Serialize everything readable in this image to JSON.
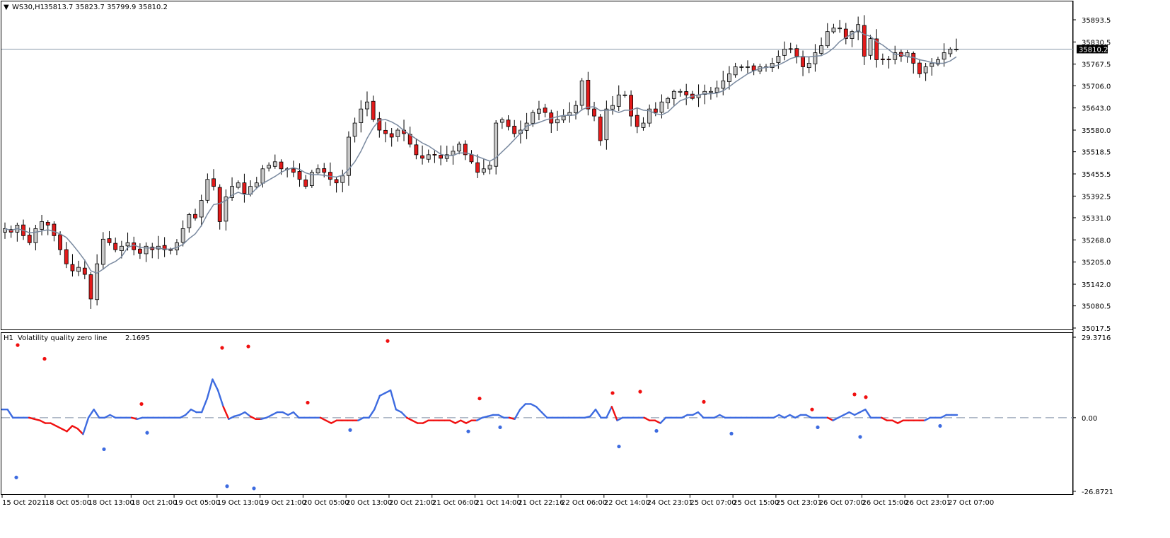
{
  "header": {
    "menu_glyph": "▼",
    "symbol": "WS30,H1",
    "ohlc": "35813.7 35823.7 35799.9 35810.2"
  },
  "indicator_header": {
    "timeframe": "H1",
    "name": "Volatility quality zero line",
    "value": "2.1695"
  },
  "colors": {
    "bull_candle": "#c8c8c8",
    "bear_candle": "#e31a1a",
    "candle_outline": "#000000",
    "moving_average": "#7a8aa0",
    "price_line": "#8899aa",
    "indicator_up": "#3d6be0",
    "indicator_down": "#f01010",
    "zero_line": "#8090a8"
  },
  "chart_data": [
    {
      "type": "candlestick",
      "name": "WS30,H1",
      "current_price": 35810.2,
      "price_label": "35810.2",
      "ylim": [
        35000,
        35930
      ],
      "y_ticks": [
        "35893.5",
        "35830.5",
        "35767.5",
        "35706.0",
        "35643.0",
        "35580.0",
        "35518.5",
        "35455.5",
        "35392.5",
        "35331.0",
        "35268.0",
        "35205.0",
        "35142.0",
        "35080.5",
        "35017.5"
      ],
      "x_ticks": [
        "15 Oct 2021",
        "18 Oct 05:00",
        "18 Oct 13:00",
        "18 Oct 21:00",
        "19 Oct 05:00",
        "19 Oct 13:00",
        "19 Oct 21:00",
        "20 Oct 05:00",
        "20 Oct 13:00",
        "20 Oct 21:00",
        "21 Oct 06:00",
        "21 Oct 14:00",
        "21 Oct 22:16",
        "22 Oct 06:00",
        "22 Oct 14:00",
        "24 Oct 23:01",
        "25 Oct 07:00",
        "25 Oct 15:00",
        "25 Oct 23:01",
        "26 Oct 07:00",
        "26 Oct 15:00",
        "26 Oct 23:01",
        "27 Oct 07:00"
      ],
      "close_path": [
        35300,
        35290,
        35310,
        35280,
        35260,
        35300,
        35320,
        35310,
        35280,
        35240,
        35200,
        35180,
        35190,
        35170,
        35100,
        35200,
        35270,
        35260,
        35240,
        35250,
        35260,
        35240,
        35230,
        35250,
        35240,
        35250,
        35240,
        35240,
        35260,
        35300,
        35340,
        35330,
        35380,
        35440,
        35420,
        35320,
        35390,
        35420,
        35430,
        35400,
        35420,
        35430,
        35470,
        35480,
        35490,
        35470,
        35470,
        35460,
        35440,
        35420,
        35460,
        35470,
        35460,
        35440,
        35430,
        35450,
        35560,
        35600,
        35640,
        35660,
        35610,
        35580,
        35570,
        35560,
        35580,
        35570,
        35540,
        35510,
        35500,
        35510,
        35510,
        35500,
        35510,
        35520,
        35540,
        35510,
        35490,
        35460,
        35470,
        35480,
        35600,
        35610,
        35590,
        35570,
        35580,
        35600,
        35630,
        35640,
        35630,
        35600,
        35610,
        35620,
        35630,
        35650,
        35720,
        35640,
        35620,
        35550,
        35640,
        35650,
        35680,
        35680,
        35620,
        35590,
        35600,
        35640,
        35630,
        35660,
        35670,
        35690,
        35690,
        35680,
        35670,
        35680,
        35690,
        35690,
        35700,
        35720,
        35740,
        35760,
        35760,
        35760,
        35750,
        35760,
        35760,
        35770,
        35790,
        35810,
        35810,
        35790,
        35760,
        35770,
        35800,
        35820,
        35860,
        35870,
        35870,
        35840,
        35860,
        35880,
        35790,
        35840,
        35780,
        35780,
        35780,
        35800,
        35790,
        35800,
        35770,
        35740,
        35760,
        35770,
        35780,
        35800,
        35810,
        35810
      ]
    },
    {
      "type": "line",
      "name": "Volatility quality zero line",
      "ylim": [
        -26.8721,
        29.3716
      ],
      "y_ticks": [
        "29.3716",
        "0.00",
        "-26.8721"
      ],
      "zero_label": "0.00",
      "series_values": [
        3,
        3,
        0,
        0,
        0,
        0,
        -0.5,
        -1,
        -2,
        -2,
        -3,
        -4,
        -5,
        -3,
        -4,
        -6,
        0,
        3,
        0,
        0,
        1,
        0,
        0,
        0,
        0,
        -0.5,
        0,
        0,
        0,
        0,
        0,
        0,
        0,
        0,
        1,
        3,
        2,
        2,
        7,
        14,
        10,
        4,
        -0.5,
        0.5,
        1,
        2,
        0.5,
        -0.5,
        -0.5,
        0,
        1,
        2,
        2,
        1,
        2,
        0,
        0,
        0,
        0,
        0,
        -1,
        -2,
        -1,
        -1,
        -1,
        -1,
        -1,
        0,
        0,
        3,
        8,
        9,
        10,
        3,
        2,
        0,
        -1,
        -2,
        -2,
        -1,
        -1,
        -1,
        -1,
        -1,
        -2,
        -1,
        -2,
        -1,
        -1,
        0,
        0.5,
        1,
        1,
        0,
        0,
        -0.5,
        3,
        5,
        5,
        4,
        2,
        0,
        0,
        0,
        0,
        0,
        0,
        0,
        0,
        0.5,
        3,
        0,
        0,
        4,
        -1,
        0,
        0,
        0,
        0,
        0,
        -1,
        -1,
        -2,
        0,
        0,
        0,
        0,
        1,
        1,
        2,
        0,
        0,
        0,
        1,
        0,
        0,
        0,
        0,
        0,
        0,
        0,
        0,
        0,
        0,
        1,
        0,
        1,
        0,
        1,
        1,
        0,
        0,
        0,
        0,
        -1,
        0,
        1,
        2,
        1,
        2,
        3,
        0,
        0,
        0,
        -1,
        -1,
        -2,
        -1,
        -1,
        -1,
        -1,
        -1,
        0,
        0,
        0,
        1,
        1,
        1
      ],
      "signal_dots": [
        {
          "x": 23,
          "y": -21.8,
          "dir": "up"
        },
        {
          "x": 25,
          "y": 26.5,
          "dir": "down"
        },
        {
          "x": 63,
          "y": 21.5,
          "dir": "down"
        },
        {
          "x": 147,
          "y": -11.5,
          "dir": "up"
        },
        {
          "x": 200,
          "y": 5,
          "dir": "down"
        },
        {
          "x": 208,
          "y": -5.5,
          "dir": "up"
        },
        {
          "x": 314,
          "y": 25.5,
          "dir": "down"
        },
        {
          "x": 321,
          "y": -25,
          "dir": "up"
        },
        {
          "x": 351,
          "y": 26,
          "dir": "down"
        },
        {
          "x": 359,
          "y": -25.8,
          "dir": "up"
        },
        {
          "x": 435,
          "y": 5.5,
          "dir": "down"
        },
        {
          "x": 495,
          "y": -4.5,
          "dir": "up"
        },
        {
          "x": 548,
          "y": 28,
          "dir": "down"
        },
        {
          "x": 662,
          "y": -5,
          "dir": "up"
        },
        {
          "x": 678,
          "y": 7,
          "dir": "down"
        },
        {
          "x": 707,
          "y": -3.5,
          "dir": "up"
        },
        {
          "x": 866,
          "y": 9,
          "dir": "down"
        },
        {
          "x": 875,
          "y": -10.5,
          "dir": "up"
        },
        {
          "x": 905,
          "y": 9.5,
          "dir": "down"
        },
        {
          "x": 928,
          "y": -4.8,
          "dir": "up"
        },
        {
          "x": 995,
          "y": 5.8,
          "dir": "down"
        },
        {
          "x": 1034,
          "y": -5.8,
          "dir": "up"
        },
        {
          "x": 1148,
          "y": 3,
          "dir": "down"
        },
        {
          "x": 1156,
          "y": -3.5,
          "dir": "up"
        },
        {
          "x": 1208,
          "y": 8.5,
          "dir": "down"
        },
        {
          "x": 1216,
          "y": -7,
          "dir": "up"
        },
        {
          "x": 1224,
          "y": 7.5,
          "dir": "down"
        },
        {
          "x": 1329,
          "y": -3,
          "dir": "up"
        }
      ]
    }
  ]
}
